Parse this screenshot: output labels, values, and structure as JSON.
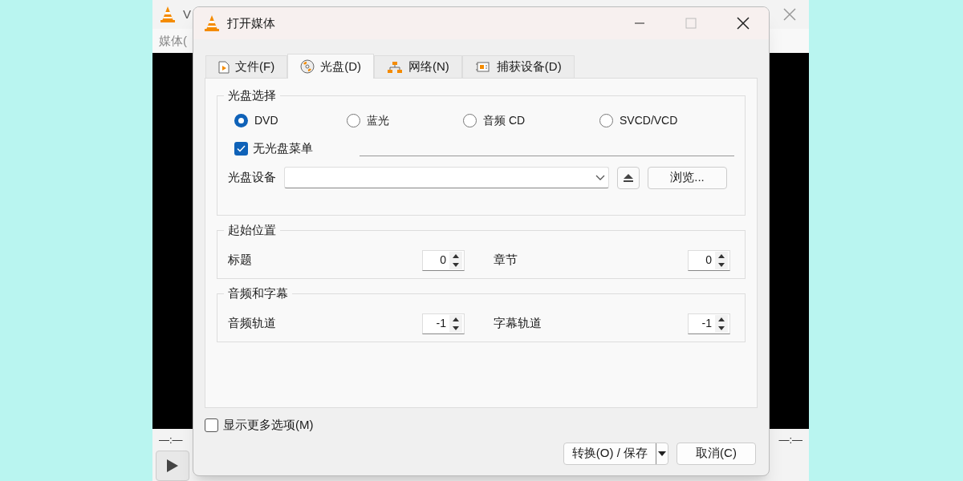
{
  "background_window": {
    "title": "V",
    "menu": "媒体(",
    "time_left": "—:—",
    "time_right": "—:—"
  },
  "dialog": {
    "title": "打开媒体"
  },
  "tabs": [
    {
      "label": "文件(F)",
      "selected": false,
      "kind": "file"
    },
    {
      "label": "光盘(D)",
      "selected": true,
      "kind": "disc"
    },
    {
      "label": "网络(N)",
      "selected": false,
      "kind": "network"
    },
    {
      "label": "捕获设备(D)",
      "selected": false,
      "kind": "capture"
    }
  ],
  "disc_selection": {
    "title": "光盘选择",
    "options": [
      {
        "label": "DVD",
        "selected": true
      },
      {
        "label": "蓝光",
        "selected": false
      },
      {
        "label": "音频 CD",
        "selected": false
      },
      {
        "label": "SVCD/VCD",
        "selected": false
      }
    ],
    "no_disc_menu": {
      "label": "无光盘菜单",
      "checked": true
    },
    "device_label": "光盘设备",
    "browse_button": "浏览..."
  },
  "start_position": {
    "title": "起始位置",
    "fields": [
      {
        "label": "标题",
        "value": "0"
      },
      {
        "label": "章节",
        "value": "0"
      }
    ]
  },
  "audio_subtitles": {
    "title": "音频和字幕",
    "fields": [
      {
        "label": "音频轨道",
        "value": "-1"
      },
      {
        "label": "字幕轨道",
        "value": "-1"
      }
    ]
  },
  "more_options": {
    "label": "显示更多选项(M)",
    "checked": false
  },
  "buttons": {
    "convert": "转换(O) / 保存",
    "cancel": "取消(C)"
  }
}
